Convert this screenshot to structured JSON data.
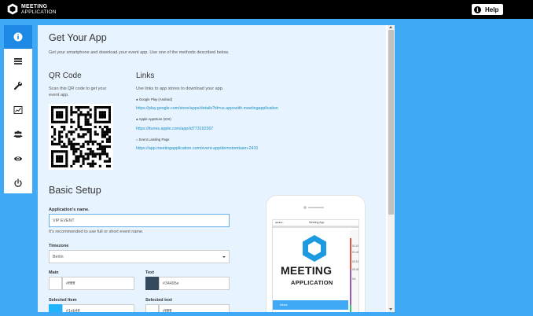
{
  "app": {
    "logo_line1": "MEETING",
    "logo_line2": "APPLICATION",
    "help_label": "Help"
  },
  "sidebar": {
    "items": [
      {
        "icon": "info-icon",
        "active": true
      },
      {
        "icon": "menu-icon",
        "active": false
      },
      {
        "icon": "wrench-icon",
        "active": false
      },
      {
        "icon": "chart-icon",
        "active": false
      },
      {
        "icon": "users-icon",
        "active": false
      },
      {
        "icon": "eye-icon",
        "active": false
      },
      {
        "icon": "power-icon",
        "active": false
      }
    ]
  },
  "get_app": {
    "title": "Get Your App",
    "intro": "Get your smartphone and download your event app. Use one of the methods described below."
  },
  "qr": {
    "title": "QR Code",
    "description": "Scan this QR code to get your event app."
  },
  "links": {
    "title": "Links",
    "description": "Use links to app stores to download your app.",
    "items": [
      {
        "label": "Google Play (Android)",
        "url": "https://play.google.com/store/apps/details?id=us.appswith.meetingapplication"
      },
      {
        "label": "Apple AppStore (iOS)",
        "url": "https://itunes.apple.com/app/id773192307"
      },
      {
        "label": "Event Landing Page",
        "url": "https://app.meetingapplication.com/event-app/demotomkaen-2431"
      }
    ]
  },
  "basic_setup": {
    "title": "Basic Setup",
    "app_name_label": "Application's name.",
    "app_name_value": "VIP EVENT",
    "app_name_help": "It's recommended to use full or short event name.",
    "timezone_label": "Timezone",
    "timezone_value": "Berlin",
    "main_label": "Main",
    "main_value": "#ffffff",
    "text_label": "Text",
    "text_value": "#34495e",
    "selected_item_label": "Selected Item",
    "selected_item_value": "#1eb4ff",
    "selected_text_label": "Selected text",
    "selected_text_value": "#ffffff"
  },
  "colors": {
    "brand_blue": "#3fa9f5",
    "active_blue": "#1e88e5",
    "text_swatch": "#34495e",
    "selected_swatch": "#1eb4ff"
  },
  "preview": {
    "status_left": "●●●●○",
    "status_center": "Meeting App",
    "status_right": "100%",
    "brand_word1": "MEETING",
    "brand_word2": "APPLICATION",
    "news_label": "News",
    "times": [
      "01:15",
      "01:45",
      "02:15",
      "03:45",
      "04:"
    ]
  }
}
